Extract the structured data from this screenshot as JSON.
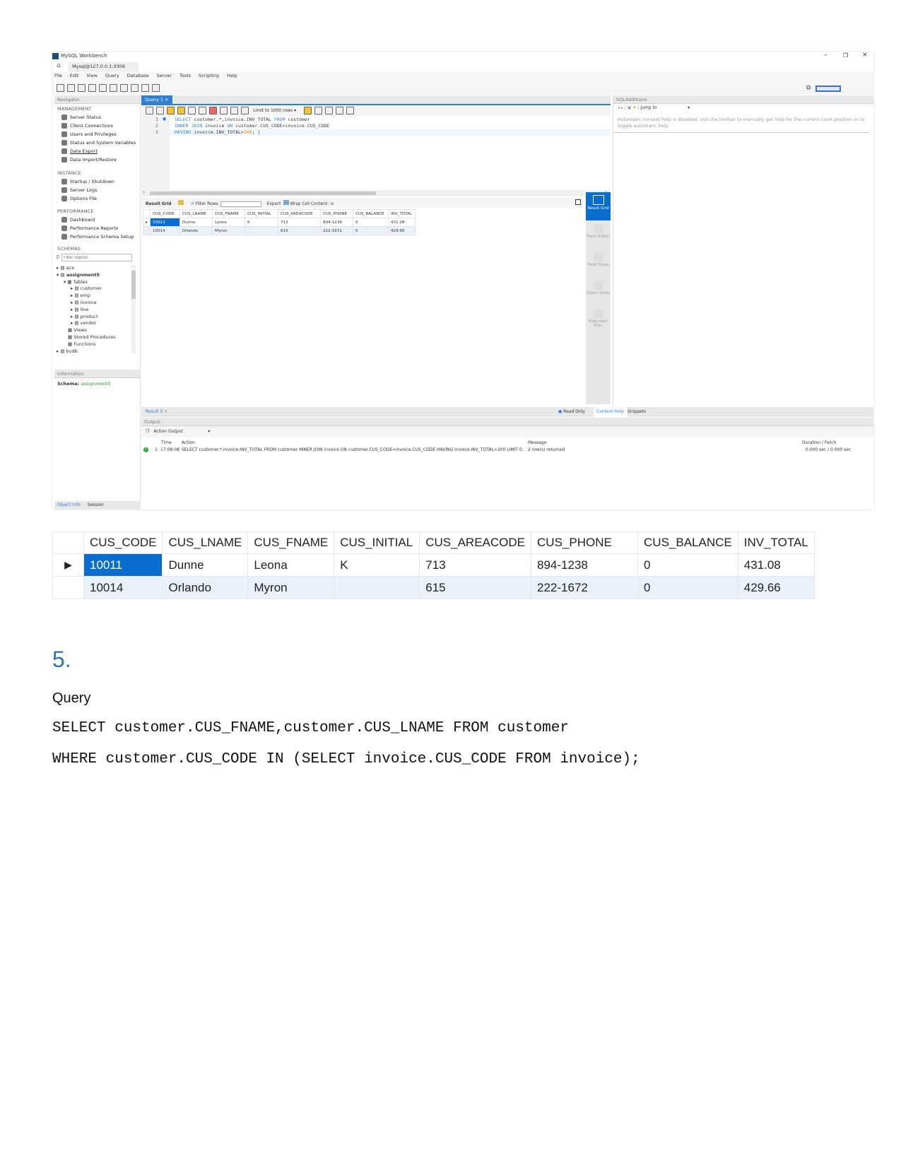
{
  "workbench": {
    "window_title": "MySQL Workbench",
    "connection_tab": "Mysql@127.0.0.1:3306",
    "menu": [
      "File",
      "Edit",
      "View",
      "Query",
      "Database",
      "Server",
      "Tools",
      "Scripting",
      "Help"
    ],
    "navigator": {
      "header": "Navigator",
      "management_label": "MANAGEMENT",
      "management": [
        "Server Status",
        "Client Connections",
        "Users and Privileges",
        "Status and System Variables",
        "Data Export",
        "Data Import/Restore"
      ],
      "instance_label": "INSTANCE",
      "instance": [
        "Startup / Shutdown",
        "Server Logs",
        "Options File"
      ],
      "performance_label": "PERFORMANCE",
      "performance": [
        "Dashboard",
        "Performance Reports",
        "Performance Schema Setup"
      ],
      "schemas_label": "SCHEMAS",
      "filter_placeholder": "Filter objects",
      "tree": {
        "schema1": "ace",
        "schema2": "assignment5",
        "tables_label": "Tables",
        "tables": [
          "customer",
          "emp",
          "invoice",
          "line",
          "product",
          "vendor"
        ],
        "views": "Views",
        "procedures": "Stored Procedures",
        "functions": "Functions",
        "schema3": "bvdb"
      },
      "information_header": "Information",
      "schema_label": "Schema:",
      "schema_value": "assignment5",
      "bottom_tabs": [
        "Object Info",
        "Session"
      ]
    },
    "query_tab": "Query 1",
    "limit_select": "Limit to 1000 rows",
    "editor": {
      "line_numbers": [
        "1",
        "2",
        "3"
      ],
      "lines": [
        {
          "kw": "SELECT",
          "rest": " customer.*,invoice.INV_TOTAL ",
          "kw2": "FROM",
          "rest2": " customer"
        },
        {
          "kw": "INNER JOIN",
          "rest": " invoice ",
          "kw2": "ON",
          "rest2": " customer.CUS_CODE=invoice.CUS_CODE"
        },
        {
          "kw": "HAVING",
          "rest": " invoice.INV_TOTAL>",
          "num": "200",
          "rest2": ";"
        }
      ]
    },
    "result_toolbar": {
      "result_grid": "Result Grid",
      "filter_rows": "Filter Rows:",
      "export": "Export:",
      "wrap": "Wrap Cell Content:"
    },
    "side_panel": [
      "Result Grid",
      "Form Editor",
      "Field Types",
      "Query Stats",
      "Execution Plan"
    ],
    "result_tab": "Result 5",
    "read_only": "Read Only",
    "output": {
      "header": "Output",
      "selector": "Action Output",
      "columns": [
        "Time",
        "Action",
        "Message",
        "Duration / Fetch"
      ],
      "row": {
        "index": "1",
        "time": "17:08:08",
        "action": "SELECT customer.*,invoice.INV_TOTAL FROM customer  INNER JOIN invoice ON customer.CUS_CODE=invoice.CUS_CODE HAVING invoice.INV_TOTAL>200 LIMIT 0, ...",
        "message": "2 row(s) returned",
        "duration": "0.000 sec / 0.000 sec"
      }
    },
    "sql_additions": {
      "header": "SQLAdditions",
      "jump_to": "Jump to",
      "help_text": "Automatic context help is disabled. Use the toolbar to manually get help for the current caret position or to toggle automatic help.",
      "tabs": [
        "Context Help",
        "Snippets"
      ]
    }
  },
  "result_table": {
    "columns": [
      "CUS_CODE",
      "CUS_LNAME",
      "CUS_FNAME",
      "CUS_INITIAL",
      "CUS_AREACODE",
      "CUS_PHONE",
      "CUS_BALANCE",
      "INV_TOTAL"
    ],
    "rows": [
      [
        "10011",
        "Dunne",
        "Leona",
        "K",
        "713",
        "894-1238",
        "0",
        "431.08"
      ],
      [
        "10014",
        "Orlando",
        "Myron",
        "",
        "615",
        "222-1672",
        "0",
        "429.66"
      ]
    ]
  },
  "section": {
    "number": "5.",
    "label": "Query",
    "sql_lines": [
      "SELECT customer.CUS_FNAME,customer.CUS_LNAME FROM customer",
      "WHERE customer.CUS_CODE IN (SELECT invoice.CUS_CODE FROM invoice);"
    ]
  },
  "colors": {
    "accent": "#0a6ed1",
    "heading": "#2e74b5",
    "keyword": "#2f7fd4",
    "schema_green": "#2a9a2a"
  }
}
